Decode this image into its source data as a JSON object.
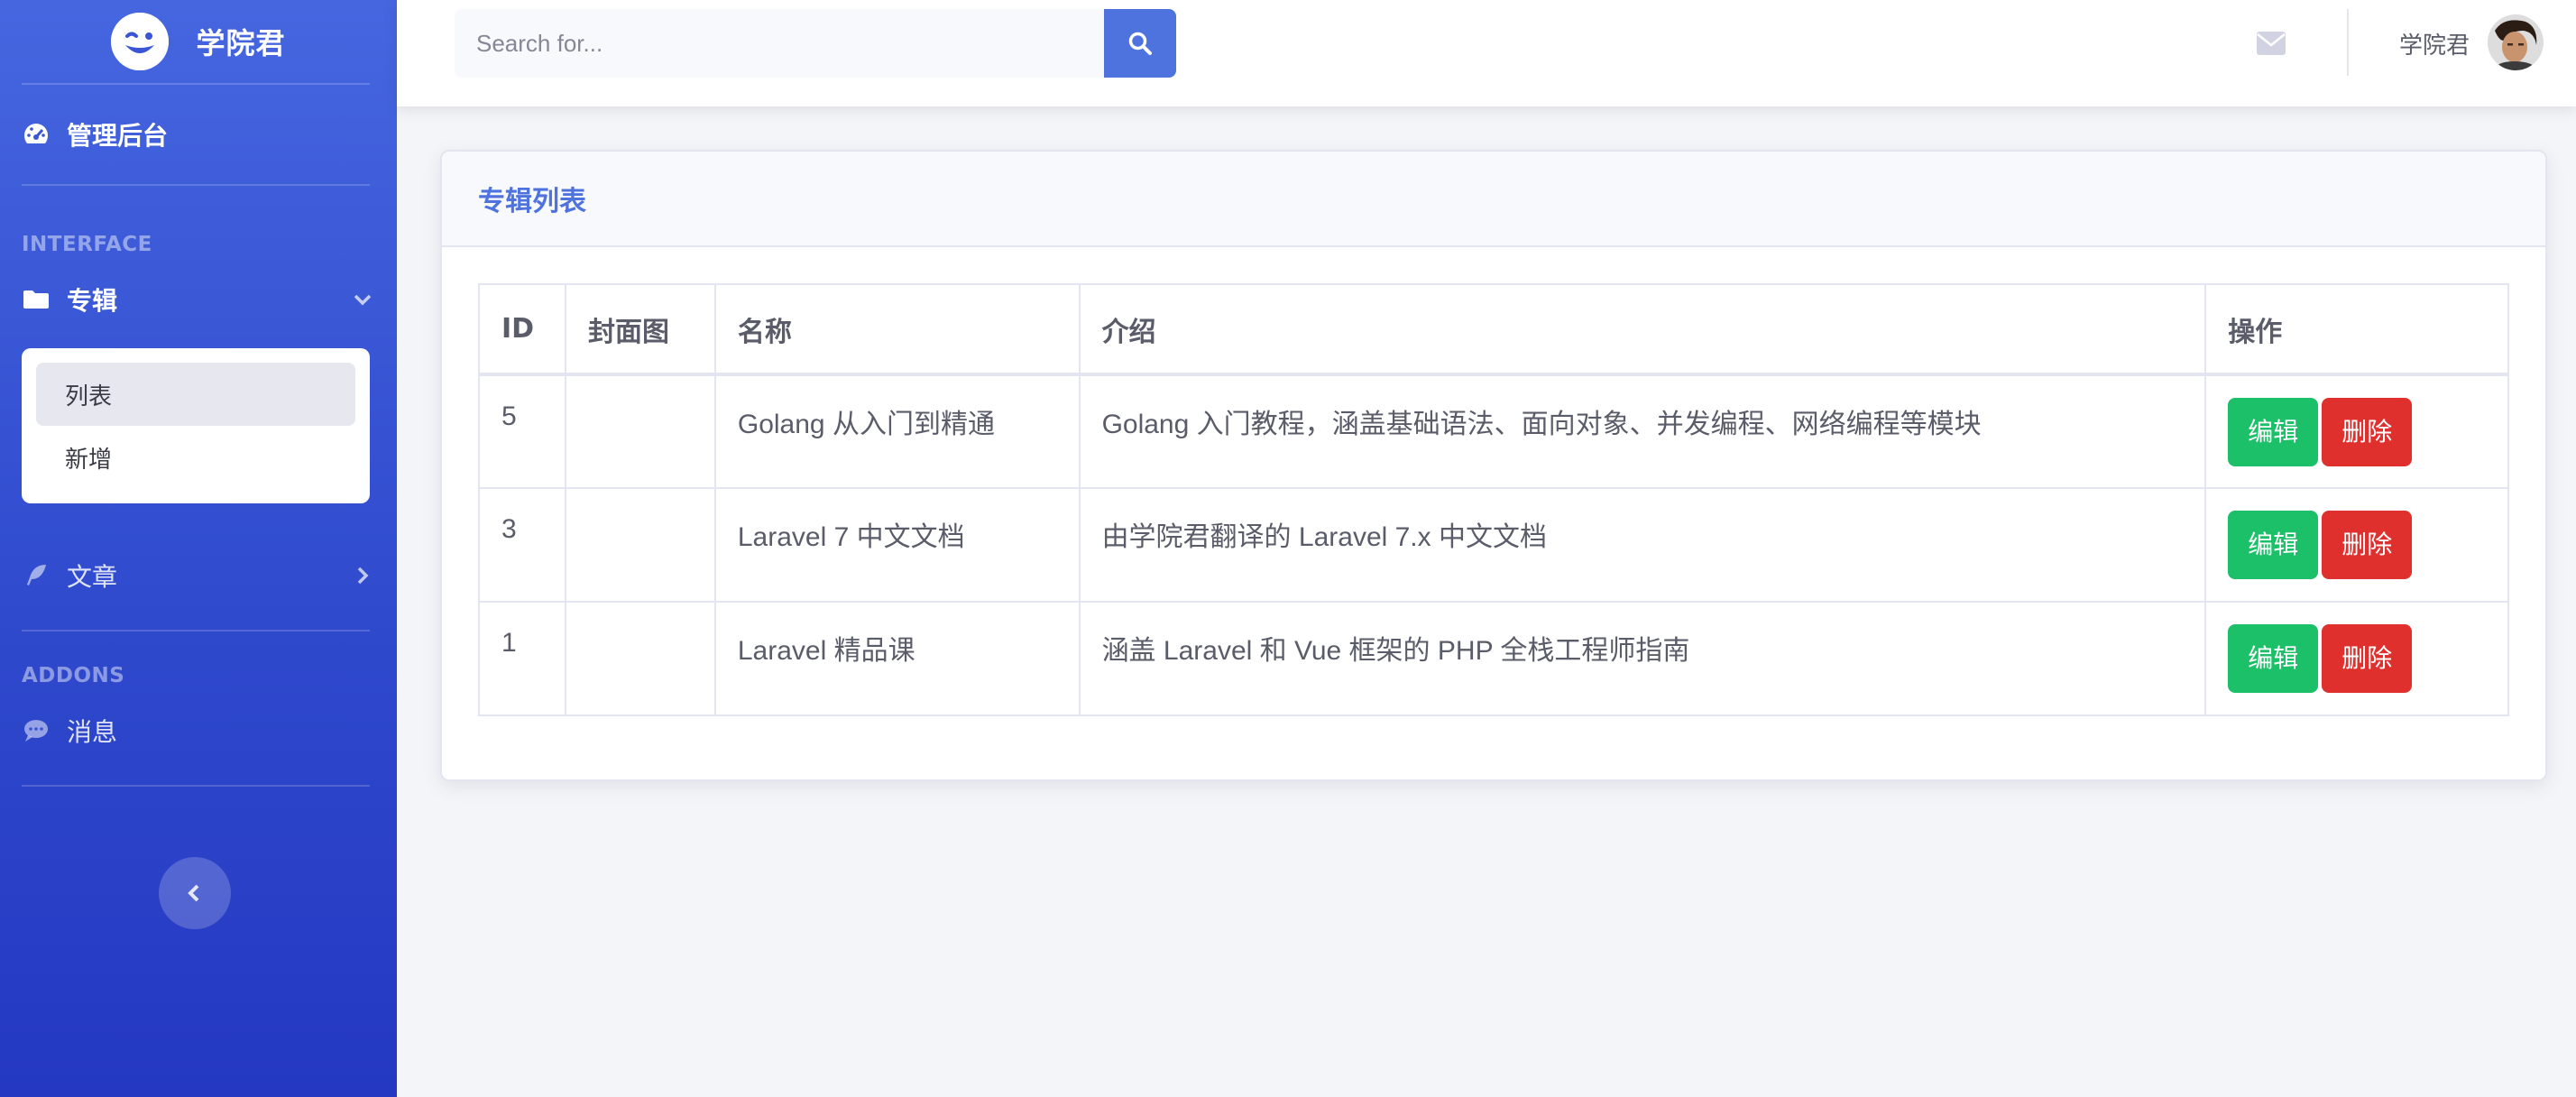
{
  "brand": {
    "name": "学院君"
  },
  "sidebar": {
    "dashboard": {
      "label": "管理后台"
    },
    "section_interface": "INTERFACE",
    "columns_menu": {
      "label": "专辑",
      "items": [
        {
          "label": "列表"
        },
        {
          "label": "新增"
        }
      ]
    },
    "articles": {
      "label": "文章"
    },
    "section_addons": "ADDONS",
    "messages": {
      "label": "消息"
    }
  },
  "topbar": {
    "search_placeholder": "Search for...",
    "user_name": "学院君"
  },
  "card": {
    "title": "专辑列表"
  },
  "table": {
    "headers": [
      "ID",
      "封面图",
      "名称",
      "介绍",
      "操作"
    ],
    "rows": [
      {
        "id": "5",
        "cover": "",
        "name": "Golang 从入门到精通",
        "intro": "Golang 入门教程，涵盖基础语法、面向对象、并发编程、网络编程等模块"
      },
      {
        "id": "3",
        "cover": "",
        "name": "Laravel 7 中文文档",
        "intro": "由学院君翻译的 Laravel 7.x 中文文档"
      },
      {
        "id": "1",
        "cover": "",
        "name": "Laravel 精品课",
        "intro": "涵盖 Laravel 和 Vue 框架的 PHP 全栈工程师指南"
      }
    ],
    "edit_label": "编辑",
    "delete_label": "删除"
  },
  "colors": {
    "primary": "#4e73df",
    "success": "#1cc069",
    "danger": "#e0302e",
    "sidebar": "#3a55d6"
  }
}
